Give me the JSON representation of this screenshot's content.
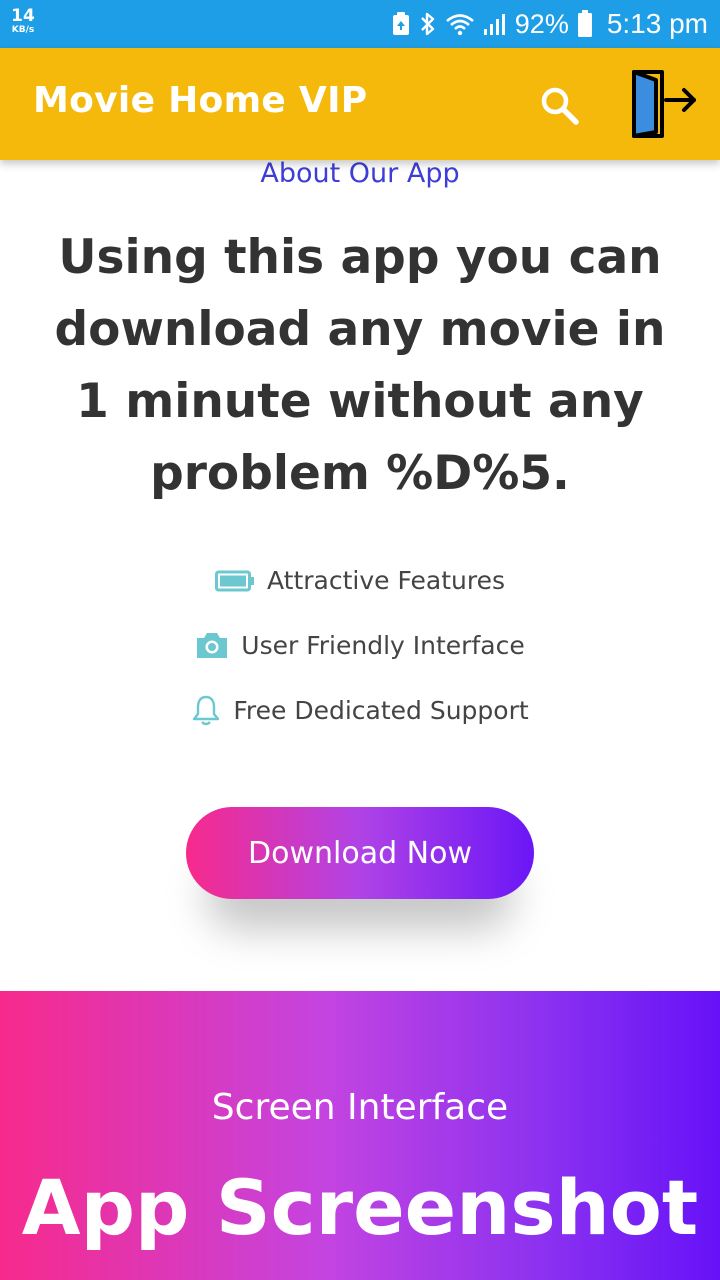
{
  "status_bar": {
    "net_speed_value": "14",
    "net_speed_unit": "KB/s",
    "battery_percent": "92%",
    "time": "5:13 pm"
  },
  "app_bar": {
    "title": "Movie Home VIP",
    "search_icon": "search-icon",
    "exit_icon": "exit-door-icon"
  },
  "about": {
    "heading": "About Our App",
    "headline": "Using this app you can download any movie in 1 minute without any problem %D%5."
  },
  "features": [
    {
      "icon": "battery-icon",
      "label": "Attractive Features"
    },
    {
      "icon": "camera-icon",
      "label": "User Friendly Interface"
    },
    {
      "icon": "bell-icon",
      "label": "Free Dedicated Support"
    }
  ],
  "cta": {
    "label": "Download Now"
  },
  "banner": {
    "subtitle": "Screen Interface",
    "title": "App Screenshot"
  },
  "colors": {
    "status_bar": "#1e9ee6",
    "app_bar": "#f5b90b",
    "accent_blue": "#3e3ed6",
    "gradient_start": "#f72a8c",
    "gradient_end": "#6612f8",
    "feature_icon": "#6cc8d0"
  }
}
